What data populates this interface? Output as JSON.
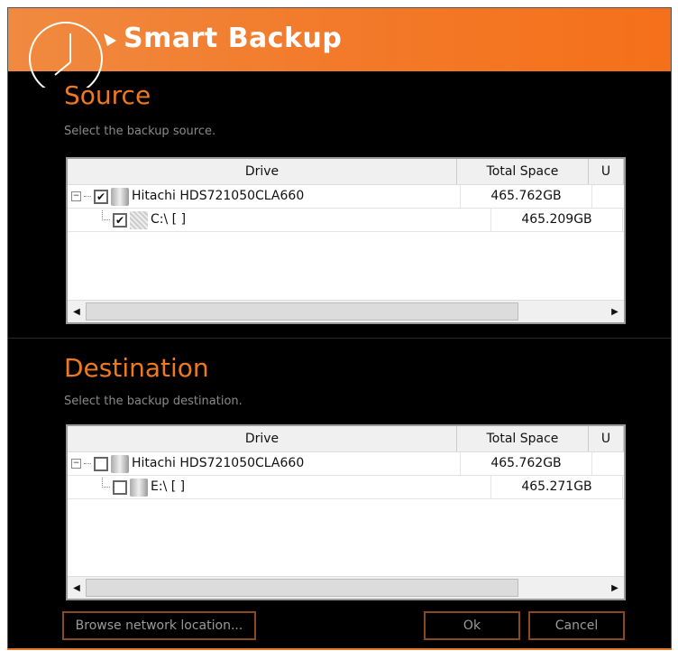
{
  "app": {
    "title": "Smart Backup"
  },
  "source": {
    "heading": "Source",
    "subtitle": "Select the backup source.",
    "columns": [
      "Drive",
      "Total Space",
      "U"
    ],
    "rows": [
      {
        "name": "Hitachi HDS721050CLA660",
        "total": "465.762GB",
        "checked": true
      },
      {
        "name": "C:\\ [ ]",
        "total": "465.209GB",
        "checked": true
      }
    ]
  },
  "destination": {
    "heading": "Destination",
    "subtitle": "Select the backup destination.",
    "columns": [
      "Drive",
      "Total Space",
      "U"
    ],
    "rows": [
      {
        "name": "Hitachi HDS721050CLA660",
        "total": "465.762GB",
        "checked": false
      },
      {
        "name": "E:\\ [ ]",
        "total": "465.271GB",
        "checked": false
      }
    ]
  },
  "buttons": {
    "browse": "Browse network location...",
    "ok": "Ok",
    "cancel": "Cancel"
  }
}
